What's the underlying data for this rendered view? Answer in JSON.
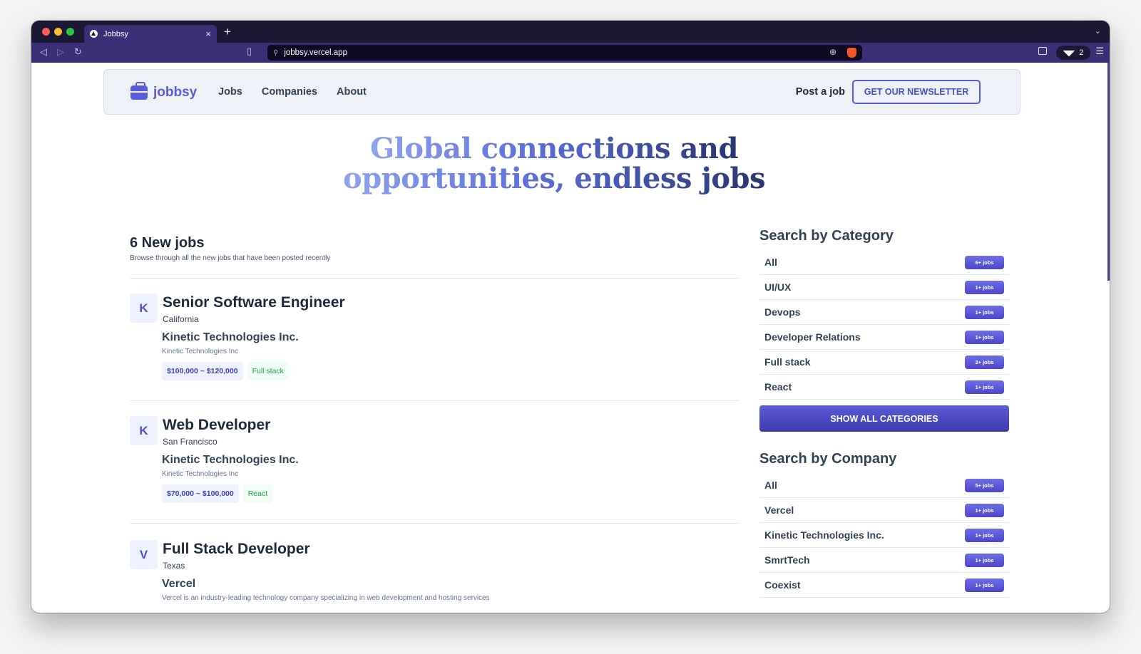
{
  "browser": {
    "tab_title": "Jobbsy",
    "tab_close": "×",
    "new_tab": "+",
    "tab_menu": "⌄",
    "url": "jobbsy.vercel.app",
    "shields_count": "2",
    "icons": [
      "back-icon",
      "forward-icon",
      "reload-icon",
      "bookmark-icon",
      "site-info-icon",
      "zoom-icon",
      "brave-shield-icon",
      "sidebar-icon",
      "menu-icon"
    ]
  },
  "header": {
    "logo_text": "jobbsy",
    "nav": [
      "Jobs",
      "Companies",
      "About"
    ],
    "post_job": "Post a job",
    "newsletter": "GET OUR NEWSLETTER"
  },
  "hero": {
    "line1": "Global connections and",
    "line2": "opportunities, endless jobs"
  },
  "jobs": {
    "title": "6 New jobs",
    "subtitle": "Browse through all the new jobs that have been posted recently",
    "items": [
      {
        "initial": "K",
        "title": "Senior Software Engineer",
        "location": "California",
        "company": "Kinetic Technologies Inc.",
        "company_desc": "Kinetic Technologies Inc",
        "salary": "$100,000 ~ $120,000",
        "category": "Full stack"
      },
      {
        "initial": "K",
        "title": "Web Developer",
        "location": "San Francisco",
        "company": "Kinetic Technologies Inc.",
        "company_desc": "Kinetic Technologies Inc",
        "salary": "$70,000 ~ $100,000",
        "category": "React"
      },
      {
        "initial": "V",
        "title": "Full Stack Developer",
        "location": "Texas",
        "company": "Vercel",
        "company_desc": "Vercel is an industry-leading technology company specializing in web development and hosting services"
      }
    ]
  },
  "categories": {
    "title": "Search by Category",
    "items": [
      {
        "label": "All",
        "count": "6+ jobs"
      },
      {
        "label": "UI/UX",
        "count": "1+ jobs"
      },
      {
        "label": "Devops",
        "count": "1+ jobs"
      },
      {
        "label": "Developer Relations",
        "count": "1+ jobs"
      },
      {
        "label": "Full stack",
        "count": "2+ jobs"
      },
      {
        "label": "React",
        "count": "1+ jobs"
      }
    ],
    "show_all": "SHOW ALL CATEGORIES"
  },
  "companies": {
    "title": "Search by Company",
    "items": [
      {
        "label": "All",
        "count": "5+ jobs"
      },
      {
        "label": "Vercel",
        "count": "1+ jobs"
      },
      {
        "label": "Kinetic Technologies Inc.",
        "count": "1+ jobs"
      },
      {
        "label": "SmrtTech",
        "count": "1+ jobs"
      },
      {
        "label": "Coexist",
        "count": "1+ jobs"
      }
    ]
  },
  "colors": {
    "accent": "#5a5bd6",
    "browser_chrome": "#3c2f78",
    "tag_green": "#16a34a"
  }
}
